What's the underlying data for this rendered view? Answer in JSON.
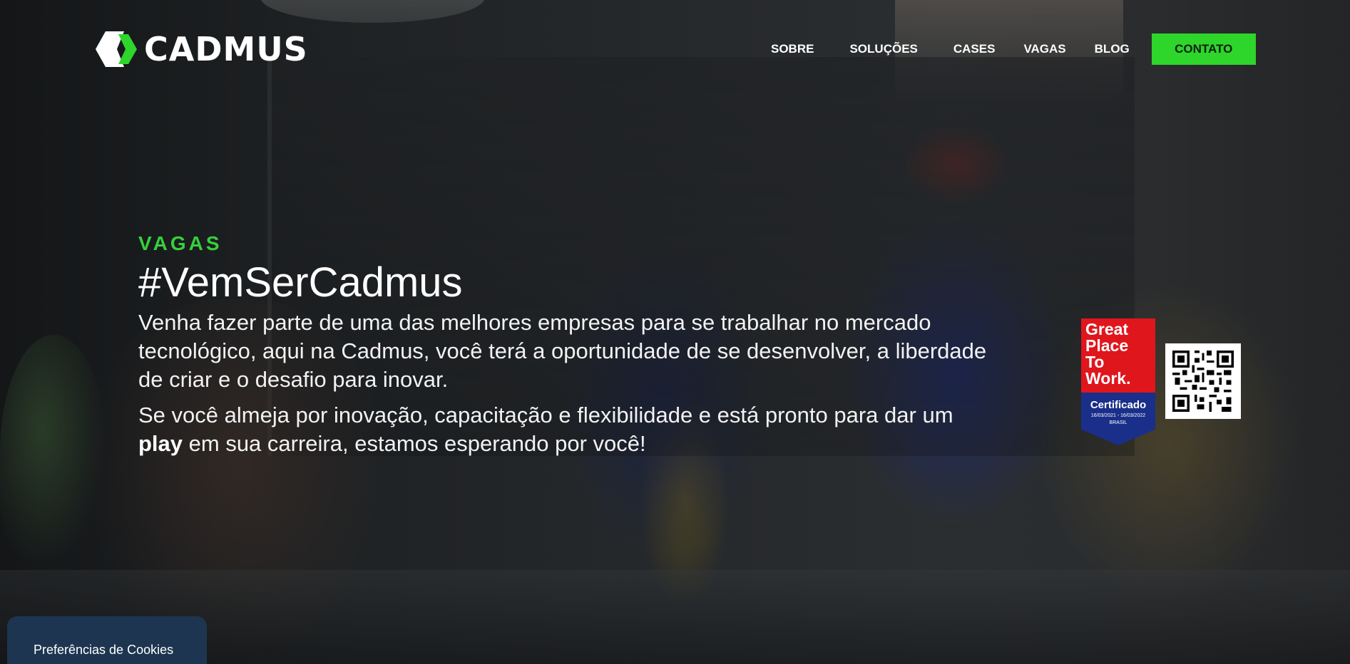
{
  "brand": {
    "name": "CADMUS",
    "colors": {
      "accent": "#2ed52b",
      "eyebrow": "#35d13a",
      "cookie_tab": "#1d3550",
      "badge_red": "#e0161d",
      "badge_blue": "#1a2f8a"
    }
  },
  "nav": {
    "links": [
      "SOBRE",
      "SOLUÇÕES",
      "CASES",
      "VAGAS",
      "BLOG"
    ],
    "cta": "CONTATO"
  },
  "hero": {
    "eyebrow": "VAGAS",
    "headline": "#VemSerCadmus",
    "paragraph1": "Venha fazer parte de uma das melhores empresas para se trabalhar no mercado tecnológico, aqui na Cadmus, você terá a oportunidade de se desenvolver, a liberdade de criar e o desafio para inovar.",
    "paragraph2_before": "Se você almeja por inovação, capacitação e flexibilidade e está pronto para dar um ",
    "paragraph2_bold": "play",
    "paragraph2_after": " em sua carreira, estamos esperando por você!"
  },
  "badge": {
    "lines": [
      "Great",
      "Place",
      "To",
      "Work."
    ],
    "certified": "Certificado",
    "dates": "16/03/2021 - 16/03/2022",
    "country": "BRASIL"
  },
  "qr_code": {
    "icon": "qr-code-icon"
  },
  "cookies": {
    "label": "Preferências de Cookies"
  }
}
